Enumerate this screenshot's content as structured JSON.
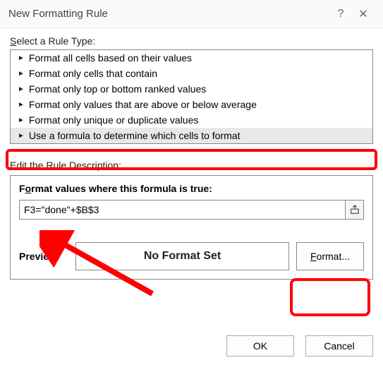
{
  "titlebar": {
    "title": "New Formatting Rule",
    "help": "?",
    "close": "✕"
  },
  "rule_type_label": "Select a Rule Type:",
  "rule_types": {
    "0": "Format all cells based on their values",
    "1": "Format only cells that contain",
    "2": "Format only top or bottom ranked values",
    "3": "Format only values that are above or below average",
    "4": "Format only unique or duplicate values",
    "5": "Use a formula to determine which cells to format"
  },
  "edit_label": "Edit the Rule Description:",
  "formula_label": "Format values where this formula is true:",
  "formula_value": "F3=\"done\"+$B$3",
  "preview_label": "Preview:",
  "preview_text": "No Format Set",
  "format_btn": "Format...",
  "ok_btn": "OK",
  "cancel_btn": "Cancel"
}
